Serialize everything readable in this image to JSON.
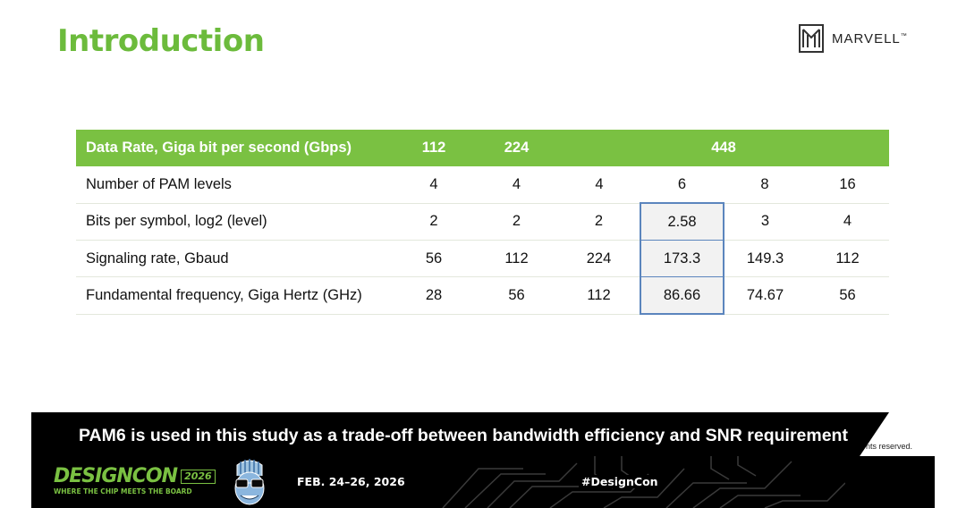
{
  "slide": {
    "title": "Introduction",
    "title_color": "#6cbb3c"
  },
  "logo": {
    "text": "MARVELL",
    "trademark": "™"
  },
  "table": {
    "header_bg": "#7ac142",
    "header": {
      "label": "Data Rate, Giga bit per second (Gbps)",
      "rate_112": "112",
      "rate_224": "224",
      "rate_448": "448"
    },
    "rows": [
      {
        "label": "Number of PAM levels",
        "values": [
          "4",
          "4",
          "4",
          "6",
          "8",
          "16"
        ]
      },
      {
        "label": "Bits per symbol, log2 (level)",
        "values": [
          "2",
          "2",
          "2",
          "2.58",
          "3",
          "4"
        ]
      },
      {
        "label": "Signaling rate, Gbaud",
        "values": [
          "56",
          "112",
          "224",
          "173.3",
          "149.3",
          "112"
        ]
      },
      {
        "label": "Fundamental frequency, Giga Hertz (GHz)",
        "values": [
          "28",
          "56",
          "112",
          "86.66",
          "74.67",
          "56"
        ]
      }
    ],
    "highlight_color": "#5b85bd"
  },
  "banner": {
    "text": "PAM6 is used in this study as a trade-off between bandwidth efficiency and SNR requirement"
  },
  "footnote": "nts reserved.",
  "footer": {
    "event_name": "DESIGNCON",
    "event_year": "2026",
    "tagline": "WHERE THE CHIP MEETS THE BOARD",
    "dates": "FEB. 24–26, 2026",
    "hashtag": "#DesignCon",
    "accent_color": "#7ac142"
  }
}
